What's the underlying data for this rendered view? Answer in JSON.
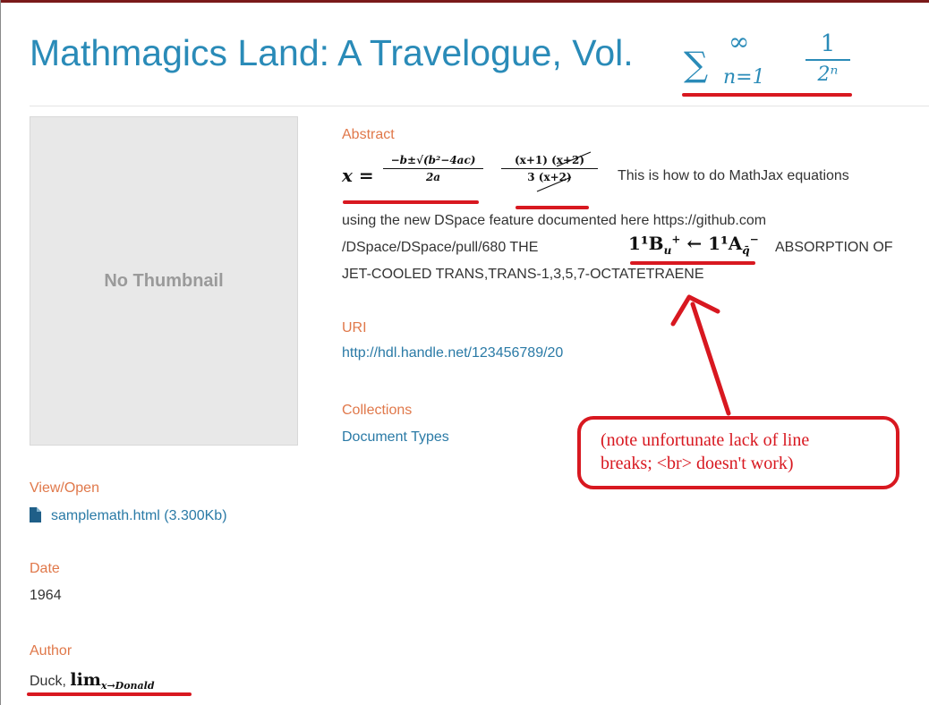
{
  "item": {
    "title_text": "Mathmagics Land: A Travelogue, Vol.",
    "title_math": {
      "sigma": "∑",
      "upper": "∞",
      "lower": "n=1",
      "numerator": "1",
      "denominator": "2ⁿ"
    },
    "thumbnail_text": "No Thumbnail"
  },
  "abstract": {
    "label": "Abstract",
    "math_x": "x =",
    "quad_num": "−b±√(b²−4ac)",
    "quad_den": "2a",
    "frac2_num": "(x+1) (x+2)",
    "frac2_den": "3 (x+2)",
    "line1_text": "This is how to do MathJax equations",
    "line2_text": "using the new DSpace feature documented here    https://github.com",
    "line3_a": "/DSpace/DSpace/pull/680    THE",
    "line3_math": "1¹B",
    "line3_math_sub": "u",
    "line3_math_sup": "+",
    "line3_arrow": " ← 1¹A",
    "line3_math_sub2": "q̄",
    "line3_math_sup2": "−",
    "line3_b": "ABSORPTION  OF",
    "line4_text": "JET-COOLED TRANS,TRANS-1,3,5,7-OCTATETRAENE"
  },
  "uri": {
    "label": "URI",
    "link": "http://hdl.handle.net/123456789/20"
  },
  "collections": {
    "label": "Collections",
    "link": "Document Types"
  },
  "view_open": {
    "label": "View/Open",
    "file_link": "samplemath.html (3.300Kb)"
  },
  "date": {
    "label": "Date",
    "value": "1964"
  },
  "author": {
    "label": "Author",
    "value": "Duck,",
    "math_lim": "lim",
    "math_sub": "x→Donald"
  },
  "annotation": {
    "line1": "(note unfortunate lack of line",
    "line2": "breaks; <br> doesn't work)",
    "color": "#d81820"
  },
  "colors": {
    "title": "#2a8bb8",
    "label": "#e0784a",
    "link": "#2a7aa6"
  }
}
